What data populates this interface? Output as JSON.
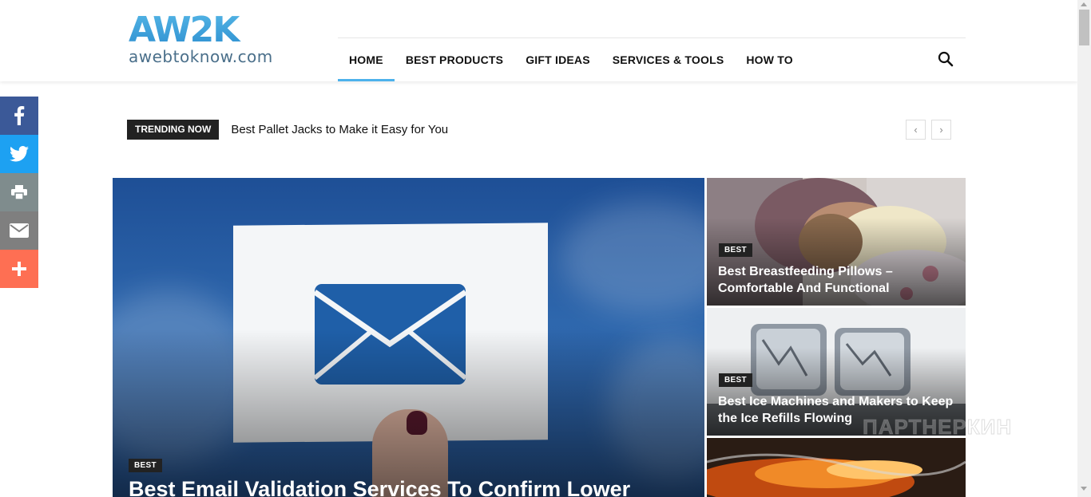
{
  "logo": {
    "text": "AW2K",
    "subtitle": "awebtoknow.com"
  },
  "nav": {
    "items": [
      {
        "label": "HOME",
        "active": true
      },
      {
        "label": "BEST PRODUCTS",
        "active": false
      },
      {
        "label": "GIFT IDEAS",
        "active": false
      },
      {
        "label": "SERVICES & TOOLS",
        "active": false
      },
      {
        "label": "HOW TO",
        "active": false
      }
    ],
    "search_icon": "search-icon"
  },
  "social": {
    "buttons": [
      {
        "name": "facebook",
        "color": "#3b5998"
      },
      {
        "name": "twitter",
        "color": "#1da1f2"
      },
      {
        "name": "print",
        "color": "#7f8c8d"
      },
      {
        "name": "email",
        "color": "#7f7f7f"
      },
      {
        "name": "more",
        "color": "#fe6f53"
      }
    ]
  },
  "trending": {
    "tag": "TRENDING NOW",
    "headline": "Best Pallet Jacks to Make it Easy for You",
    "prev": "‹",
    "next": "›"
  },
  "featured": {
    "main": {
      "badge": "BEST",
      "title": "Best Email Validation Services To Confirm Lower"
    },
    "side": [
      {
        "badge": "BEST",
        "title": "Best Breastfeeding Pillows – Comfortable And Functional"
      },
      {
        "badge": "BEST",
        "title": "Best Ice Machines and Makers to Keep the Ice Refills Flowing"
      }
    ]
  },
  "watermark": "ПАРТНЕРКИН",
  "colors": {
    "accent": "#4db2ec",
    "badge_bg": "#222222"
  }
}
